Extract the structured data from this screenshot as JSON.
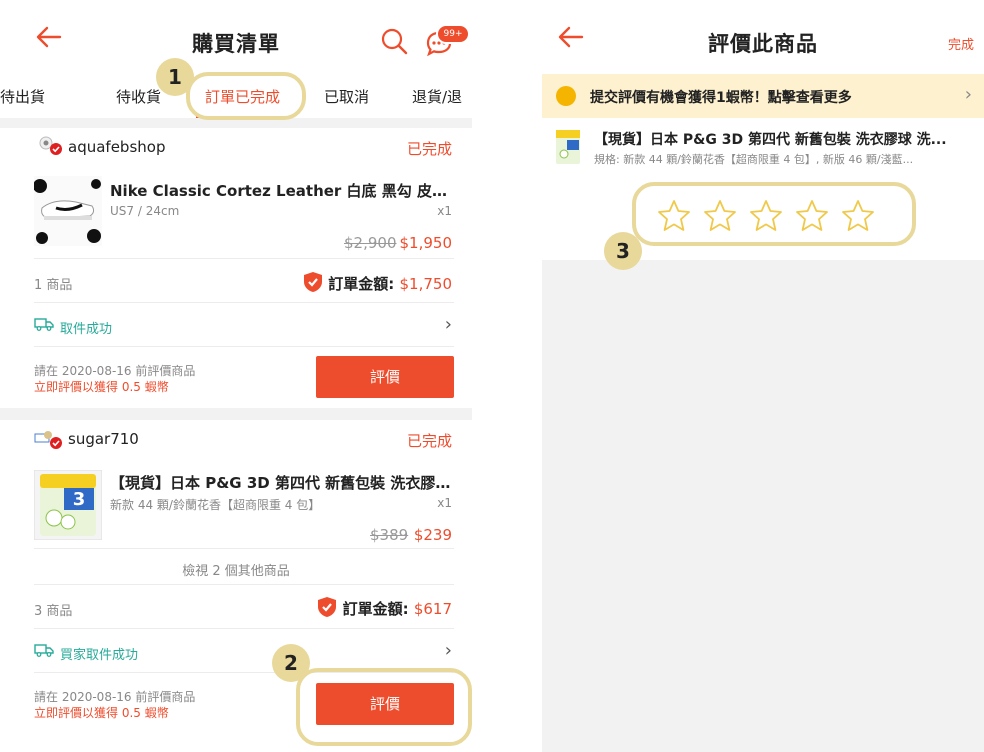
{
  "left": {
    "title": "購買清單",
    "badge": "99+",
    "tabs": [
      "待出貨",
      "待收貨",
      "訂單已完成",
      "已取消",
      "退貨/退"
    ],
    "orders": [
      {
        "shop": "aquafebshop",
        "status": "已完成",
        "product": "Nike Classic Cortez Leather 白底 黑勾 皮革 阿...",
        "variant": "US7 / 24cm",
        "qty": "x1",
        "old_price": "$2,900",
        "price": "$1,950",
        "count": "1 商品",
        "total_label": "訂單金額:",
        "total": "$1,750",
        "shipping": "取件成功",
        "hint_date": "請在 2020-08-16 前評價商品",
        "hint_reward": "立即評價以獲得 0.5 蝦幣",
        "button": "評價"
      },
      {
        "shop": "sugar710",
        "status": "已完成",
        "product": "【現貨】日本 P&G 3D 第四代 新舊包裝 洗衣膠...",
        "variant": "新款 44 顆/鈴蘭花香【超商限重 4 包】",
        "qty": "x1",
        "old_price": "$389",
        "price": "$239",
        "more": "檢視 2 個其他商品",
        "count": "3 商品",
        "total_label": "訂單金額:",
        "total": "$617",
        "shipping": "買家取件成功",
        "hint_date": "請在 2020-08-16 前評價商品",
        "hint_reward": "立即評價以獲得 0.5 蝦幣",
        "button": "評價"
      }
    ],
    "thumb_label": "3"
  },
  "right": {
    "title": "評價此商品",
    "done": "完成",
    "banner": "提交評價有機會獲得1蝦幣！點擊查看更多",
    "product": "【現貨】日本 P&G 3D 第四代 新舊包裝 洗衣膠球 洗...",
    "spec": "規格: 新款 44 顆/鈴蘭花香【超商限重 4 包】, 新版 46 顆/淺藍...",
    "rating": 0,
    "max_rating": 5
  },
  "annotations": [
    "1",
    "2",
    "3"
  ],
  "colors": {
    "accent": "#ee4d2d",
    "highlight": "#e8d89a",
    "teal": "#26aa99"
  }
}
